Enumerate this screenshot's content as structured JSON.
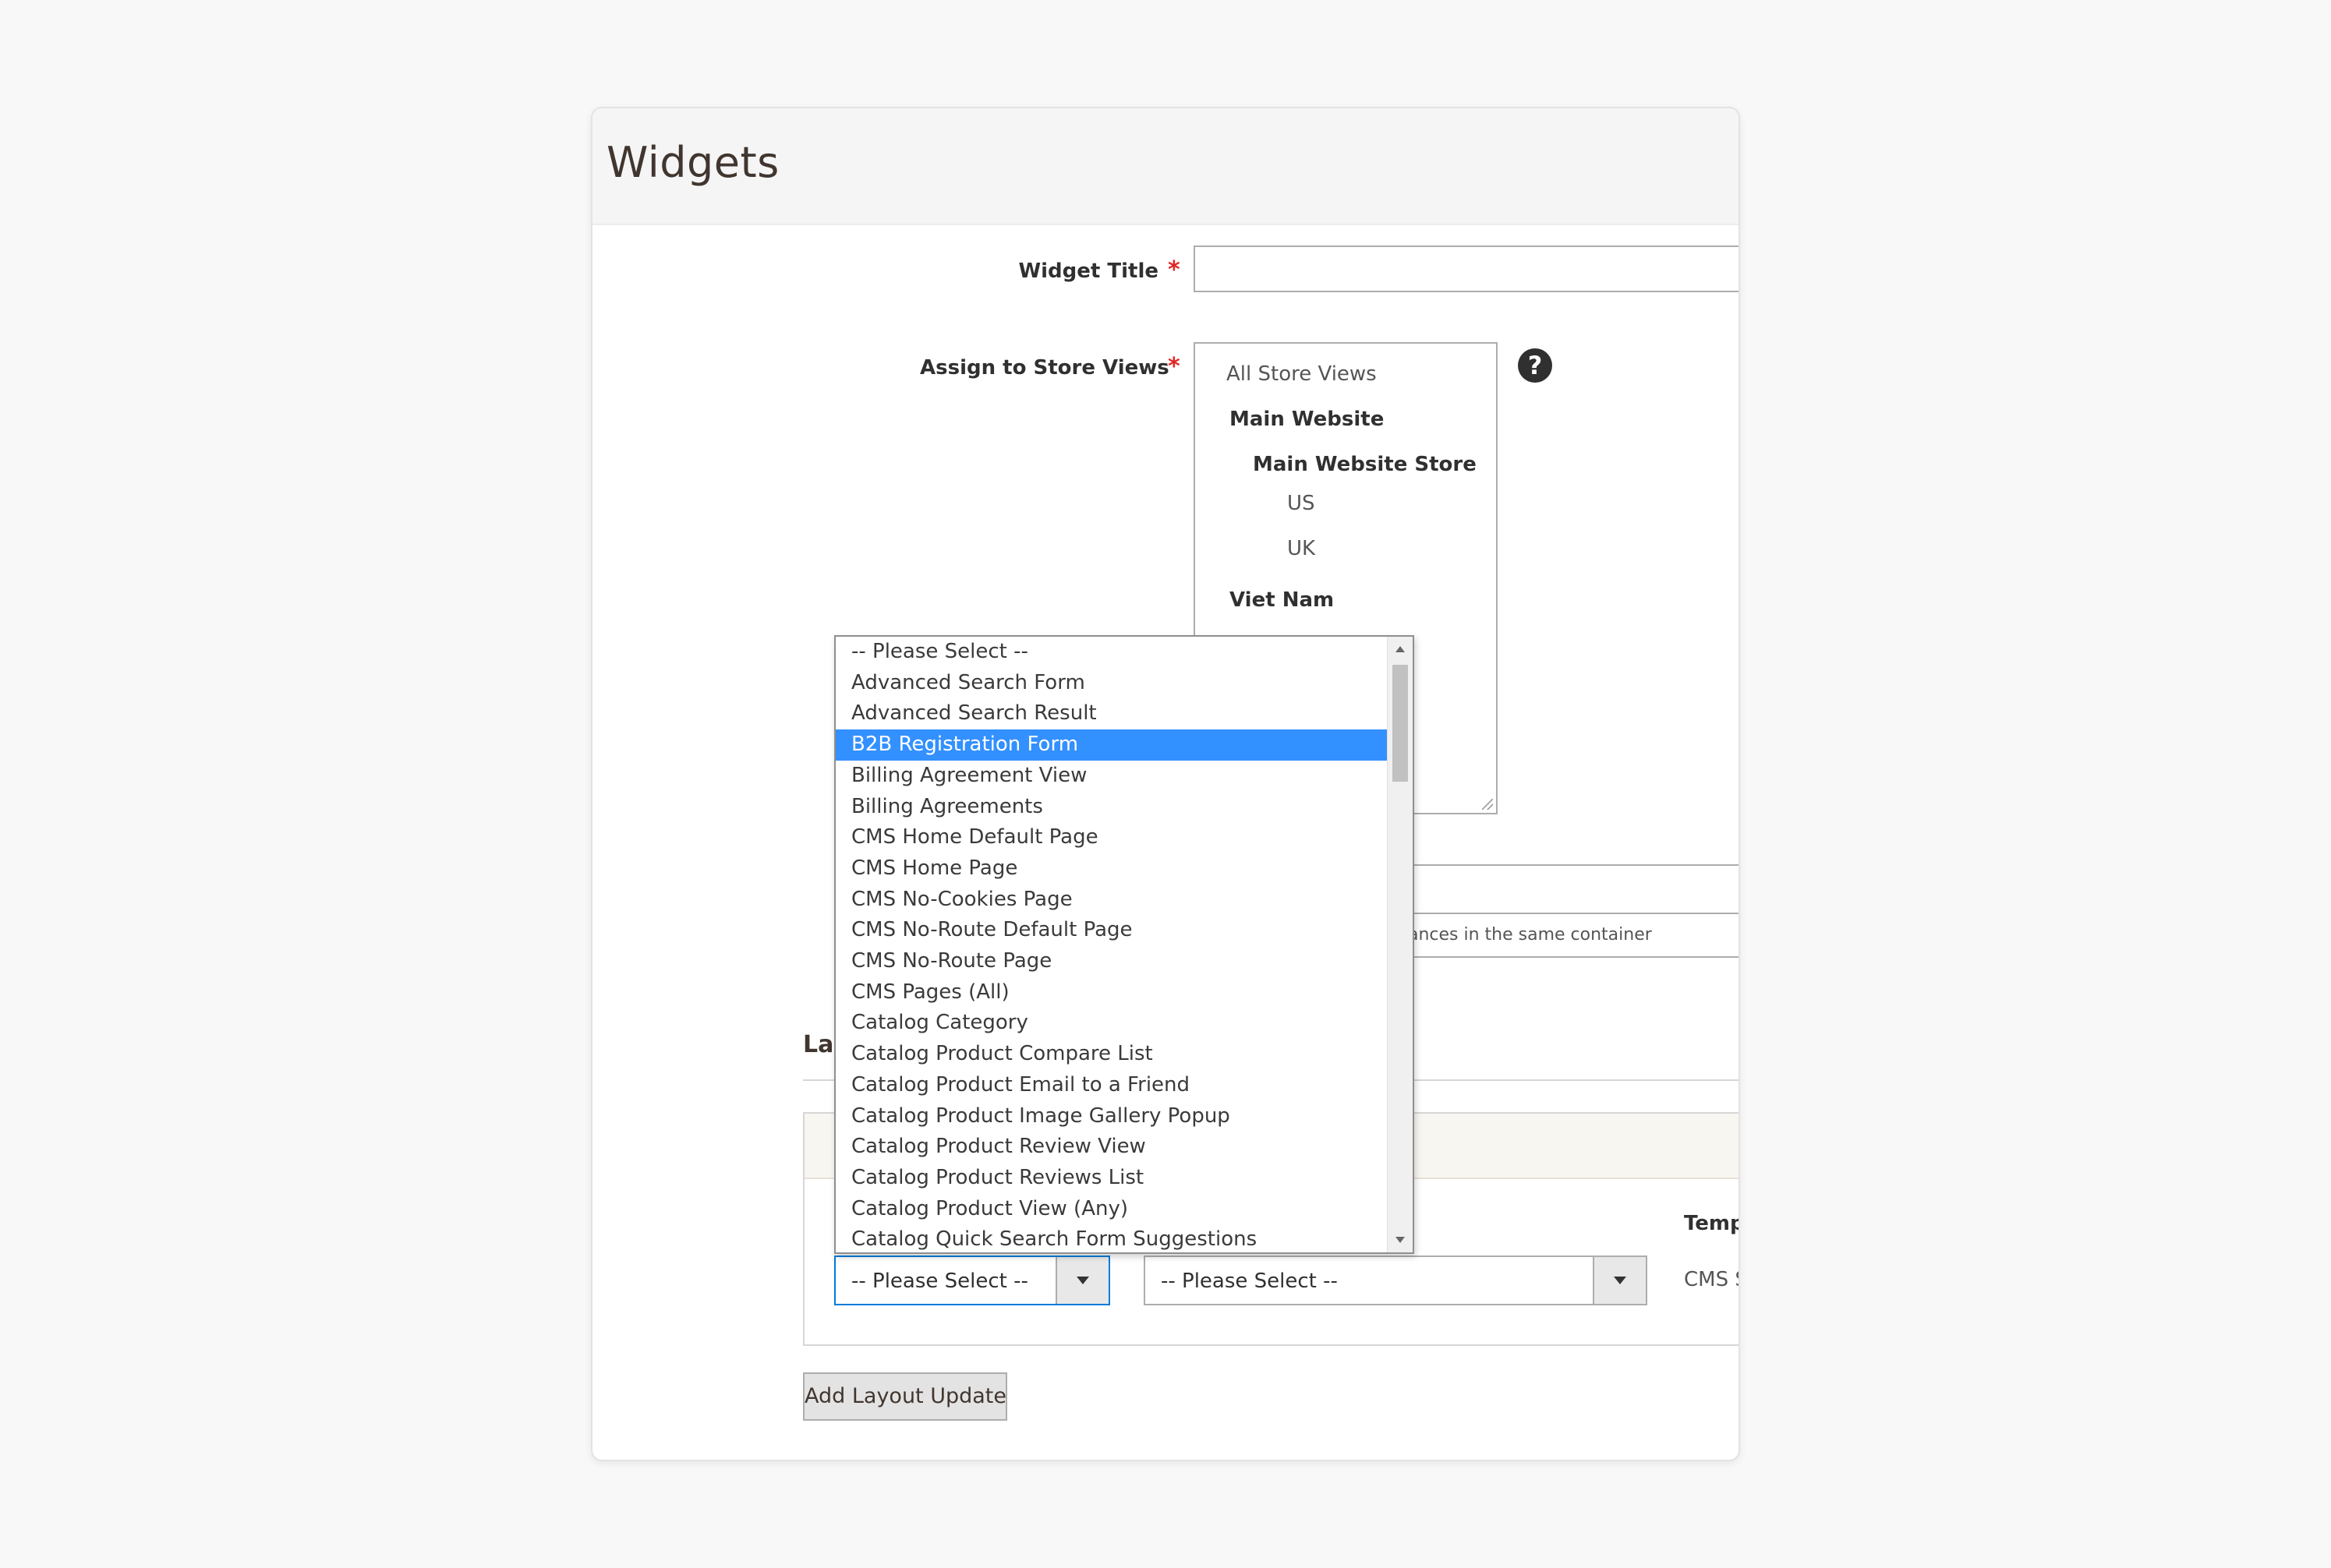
{
  "page": {
    "title": "Widgets"
  },
  "form": {
    "widget_title": {
      "label": "Widget Title",
      "value": "",
      "required_mark": "*"
    },
    "store_views": {
      "label": "Assign to Store Views",
      "required_mark": "*",
      "help_icon": "question-circle-icon",
      "options": [
        {
          "label": "All Store Views",
          "style": "light"
        },
        {
          "label": "Main Website",
          "style": "bold"
        },
        {
          "label": "Main Website Store",
          "style": "bold"
        },
        {
          "label": "US",
          "style": "light"
        },
        {
          "label": "UK",
          "style": "light"
        },
        {
          "label": "Viet Nam",
          "style": "bold"
        }
      ]
    },
    "partial_note": "ances in the same container"
  },
  "layout_updates": {
    "section_title": "La",
    "template_label": "Temp",
    "template_value": "CMS S",
    "display_on_select": {
      "value": "-- Please Select --"
    },
    "container_select": {
      "value": "-- Please Select --"
    },
    "add_button": "Add Layout Update"
  },
  "dropdown": {
    "selected_index": 3,
    "options": [
      "-- Please Select --",
      "Advanced Search Form",
      "Advanced Search Result",
      "B2B Registration Form",
      "Billing Agreement View",
      "Billing Agreements",
      "CMS Home Default Page",
      "CMS Home Page",
      "CMS No-Cookies Page",
      "CMS No-Route Default Page",
      "CMS No-Route Page",
      "CMS Pages (All)",
      "Catalog Category",
      "Catalog Product Compare List",
      "Catalog Product Email to a Friend",
      "Catalog Product Image Gallery Popup",
      "Catalog Product Review View",
      "Catalog Product Reviews List",
      "Catalog Product View (Any)",
      "Catalog Quick Search Form Suggestions"
    ]
  },
  "colors": {
    "accent_focus": "#007bdb",
    "selection": "#3390ff",
    "required": "#e22626"
  }
}
